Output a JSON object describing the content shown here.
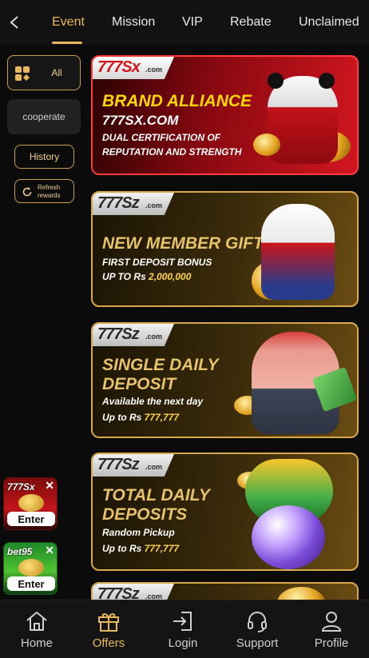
{
  "tabs": [
    {
      "label": "Event",
      "active": true
    },
    {
      "label": "Mission",
      "active": false
    },
    {
      "label": "VIP",
      "active": false
    },
    {
      "label": "Rebate",
      "active": false
    },
    {
      "label": "Unclaimed",
      "active": false
    }
  ],
  "sidebar": {
    "all_label": "All",
    "cooperate_label": "cooperate",
    "history_label": "History",
    "refresh_label": "Refresh rewards"
  },
  "mini_apps": [
    {
      "brand": "777Sx",
      "enter_label": "Enter",
      "close": "✕"
    },
    {
      "brand": "bet95",
      "enter_label": "Enter",
      "close": "✕"
    }
  ],
  "cards": [
    {
      "brand": "777Sx",
      "brand_suffix": ".com",
      "title": "BRAND ALLIANCE",
      "site": "777SX.COM",
      "lines": [
        "DUAL CERTIFICATION OF",
        "REPUTATION AND STRENGTH"
      ]
    },
    {
      "brand": "777Sz",
      "brand_suffix": ".com",
      "title": "NEW MEMBER GIFT",
      "line1": "FIRST DEPOSIT BONUS",
      "line2_prefix": "UP TO Rs ",
      "line2_value": "2,000,000"
    },
    {
      "brand": "777Sz",
      "brand_suffix": ".com",
      "title_lines": [
        "SINGLE DAILY",
        "DEPOSIT"
      ],
      "line1": "Available the next day",
      "line2_prefix": "Up to Rs ",
      "line2_value": "777,777"
    },
    {
      "brand": "777Sz",
      "brand_suffix": ".com",
      "title_lines": [
        "TOTAL DAILY",
        "DEPOSITS"
      ],
      "line1": "Random Pickup",
      "line2_prefix": "Up to Rs ",
      "line2_value": "777,777"
    },
    {
      "brand": "777Sz",
      "brand_suffix": ".com"
    }
  ],
  "bottom_nav": [
    {
      "label": "Home",
      "icon": "home-icon",
      "active": false
    },
    {
      "label": "Offers",
      "icon": "gift-icon",
      "active": true
    },
    {
      "label": "Login",
      "icon": "login-icon",
      "active": false
    },
    {
      "label": "Support",
      "icon": "headset-icon",
      "active": false
    },
    {
      "label": "Profile",
      "icon": "user-icon",
      "active": false
    }
  ],
  "colors": {
    "accent": "#e9b85a",
    "background": "#0b0b0b",
    "promo_red": "#d21620"
  }
}
